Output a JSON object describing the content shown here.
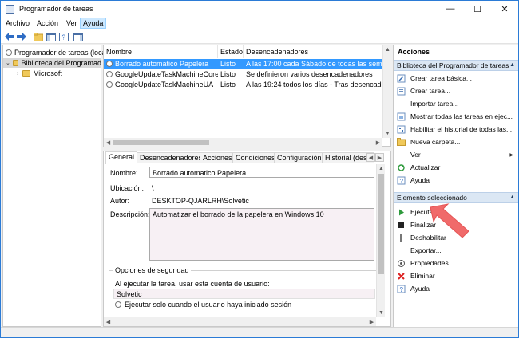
{
  "window": {
    "title": "Programador de tareas",
    "minimize": "—",
    "maximize": "☐",
    "close": "✕"
  },
  "menu": [
    "Archivo",
    "Acción",
    "Ver",
    "Ayuda"
  ],
  "tree": {
    "root": "Programador de tareas (local",
    "library": "Biblioteca del Programad",
    "microsoft": "Microsoft"
  },
  "task_table": {
    "headers": [
      "Nombre",
      "Estado",
      "Desencadenadores"
    ],
    "rows": [
      {
        "name": "Borrado automatico Papelera",
        "state": "Listo",
        "trigger": "A las 17:00 cada Sábado de todas las semanas, a partir de",
        "selected": true
      },
      {
        "name": "GoogleUpdateTaskMachineCore",
        "state": "Listo",
        "trigger": "Se definieron varios desencadenadores",
        "selected": false
      },
      {
        "name": "GoogleUpdateTaskMachineUA",
        "state": "Listo",
        "trigger": "A las 19:24 todos los días - Tras desencadenarse, repetir c",
        "selected": false
      }
    ]
  },
  "details": {
    "tabs": [
      "General",
      "Desencadenadores",
      "Acciones",
      "Condiciones",
      "Configuración",
      "Historial (desh"
    ],
    "name_label": "Nombre:",
    "name_value": "Borrado automatico Papelera",
    "location_label": "Ubicación:",
    "location_value": "\\",
    "author_label": "Autor:",
    "author_value": "DESKTOP-QJARLRH\\Solvetic",
    "description_label": "Descripción:",
    "description_value": "Automatizar el borrado de la papelera en Windows 10",
    "security_title": "Opciones de seguridad",
    "security_text": "Al ejecutar la tarea, usar esta cuenta de usuario:",
    "security_user": "Solvetic",
    "run_only_logged": "Ejecutar solo cuando el usuario haya iniciado sesión"
  },
  "actions": {
    "title": "Acciones",
    "section_library": "Biblioteca del Programador de tareas",
    "library_items": [
      {
        "label": "Crear tarea básica...",
        "icon": "wizard-icon"
      },
      {
        "label": "Crear tarea...",
        "icon": "new-task-icon"
      },
      {
        "label": "Importar tarea...",
        "icon": ""
      },
      {
        "label": "Mostrar todas las tareas en ejec...",
        "icon": "running-tasks-icon"
      },
      {
        "label": "Habilitar el historial de todas las...",
        "icon": "history-icon"
      },
      {
        "label": "Nueva carpeta...",
        "icon": "folder-icon"
      },
      {
        "label": "Ver",
        "icon": ""
      },
      {
        "label": "Actualizar",
        "icon": "refresh-icon"
      },
      {
        "label": "Ayuda",
        "icon": "help-icon"
      }
    ],
    "section_selected": "Elemento seleccionado",
    "selected_items": [
      {
        "label": "Ejecutar",
        "icon": "run-icon"
      },
      {
        "label": "Finalizar",
        "icon": "stop-icon"
      },
      {
        "label": "Deshabilitar",
        "icon": "disable-icon"
      },
      {
        "label": "Exportar...",
        "icon": ""
      },
      {
        "label": "Propiedades",
        "icon": "properties-icon"
      },
      {
        "label": "Eliminar",
        "icon": "delete-icon"
      },
      {
        "label": "Ayuda",
        "icon": "help-icon"
      }
    ],
    "submenu_arrow": "▶"
  },
  "colors": {
    "selection": "#3399ff",
    "section_header": "#dbe7f4",
    "annotation_arrow": "#f06a6a"
  },
  "annotation": {
    "type": "arrow",
    "points_to": "Ejecutar"
  }
}
